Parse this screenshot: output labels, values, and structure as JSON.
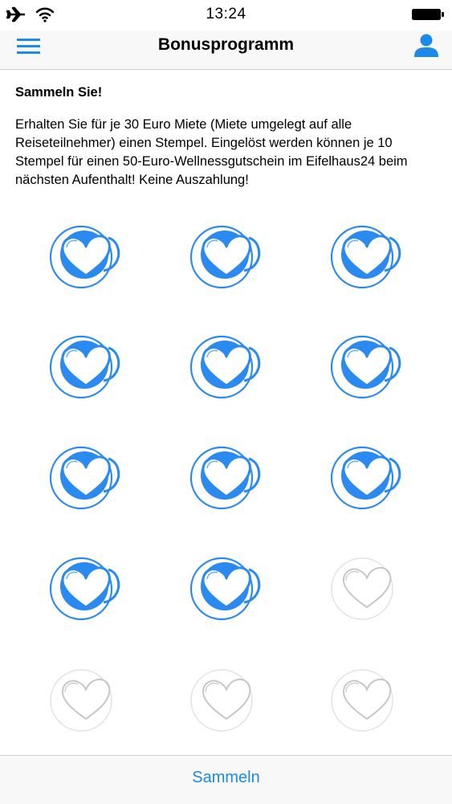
{
  "status_bar": {
    "time": "13:24",
    "icons": [
      "airplane-icon",
      "wifi-icon",
      "battery-icon"
    ]
  },
  "nav": {
    "title": "Bonusprogramm",
    "left_icon": "menu-icon",
    "right_icon": "user-icon"
  },
  "content": {
    "heading": "Sammeln Sie!",
    "body": "Erhalten Sie für je 30 Euro Miete (Miete umgelegt auf alle Reiseteilnehmer) einen Stempel. Eingelöst werden können je 10 Stempel für einen 50-Euro-Wellnessgutschein im Eifelhaus24 beim nächsten Aufenthalt! Keine Auszahlung!"
  },
  "stamps": {
    "total": 15,
    "collected": 11,
    "filled_icon": "blue-heart-stamp-icon",
    "empty_icon": "empty-heart-stamp-icon"
  },
  "tab_bar": {
    "button_label": "Sammeln"
  },
  "colors": {
    "accent": "#1b8ae9",
    "stamp_fill": "#2a8af0",
    "stamp_empty": "#c8c6cb"
  }
}
